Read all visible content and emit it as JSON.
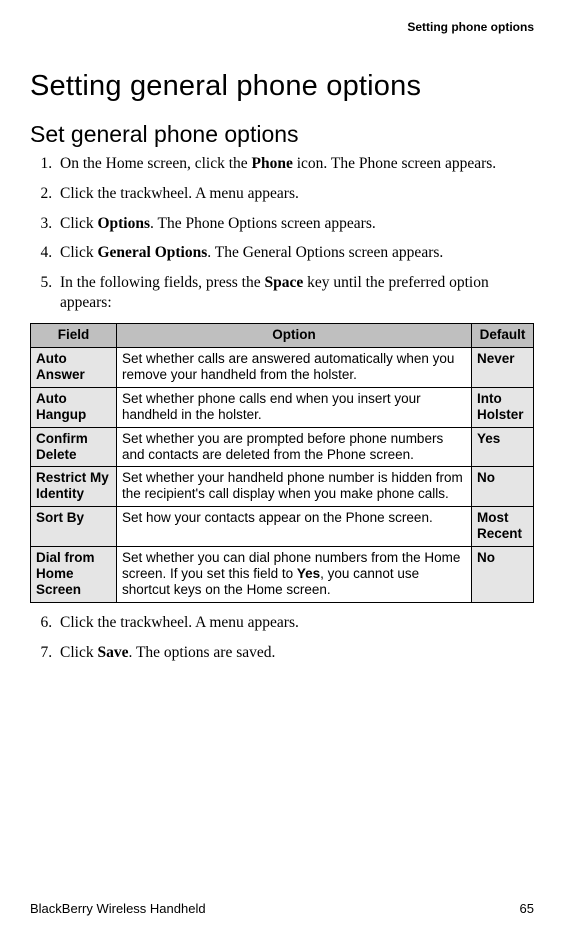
{
  "header": {
    "running": "Setting phone options"
  },
  "titles": {
    "h1": "Setting general phone options",
    "h2": "Set general phone options"
  },
  "steps_a": [
    {
      "pre": "On the Home screen, click the ",
      "bold": "Phone",
      "post": " icon. The Phone screen appears."
    },
    {
      "pre": "Click the trackwheel. A menu appears.",
      "bold": "",
      "post": ""
    },
    {
      "pre": "Click ",
      "bold": "Options",
      "post": ". The Phone Options screen appears."
    },
    {
      "pre": "Click ",
      "bold": "General Options",
      "post": ". The General Options screen appears."
    },
    {
      "pre": "In the following fields, press the ",
      "bold": "Space",
      "post": " key until the preferred option appears:"
    }
  ],
  "table": {
    "headers": {
      "field": "Field",
      "option": "Option",
      "def": "Default"
    },
    "rows": [
      {
        "field": "Auto Answer",
        "option_pre": "Set whether calls are answered automatically when you remove your handheld from the holster.",
        "option_bold": "",
        "option_post": "",
        "def": "Never"
      },
      {
        "field": "Auto Hangup",
        "option_pre": "Set whether phone calls end when you insert your handheld in the holster.",
        "option_bold": "",
        "option_post": "",
        "def": "Into Holster"
      },
      {
        "field": "Confirm Delete",
        "option_pre": "Set whether you are prompted before phone numbers and contacts are deleted from the Phone screen.",
        "option_bold": "",
        "option_post": "",
        "def": "Yes"
      },
      {
        "field": "Restrict My Identity",
        "option_pre": "Set whether your handheld phone number is hidden from the recipient's call display when you make phone calls.",
        "option_bold": "",
        "option_post": "",
        "def": "No"
      },
      {
        "field": "Sort By",
        "option_pre": "Set how your contacts appear on the Phone screen.",
        "option_bold": "",
        "option_post": "",
        "def": "Most Recent"
      },
      {
        "field": "Dial from Home Screen",
        "option_pre": "Set whether you can dial phone numbers from the Home screen. If you set this field to ",
        "option_bold": "Yes",
        "option_post": ", you cannot use shortcut keys on the Home screen.",
        "def": "No"
      }
    ]
  },
  "steps_b": [
    {
      "pre": "Click the trackwheel. A menu appears.",
      "bold": "",
      "post": ""
    },
    {
      "pre": "Click ",
      "bold": "Save",
      "post": ". The options are saved."
    }
  ],
  "footer": {
    "product": "BlackBerry Wireless Handheld",
    "page": "65"
  }
}
